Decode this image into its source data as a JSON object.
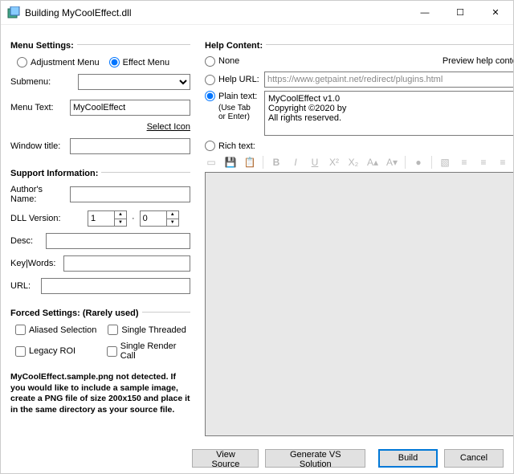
{
  "title": "Building MyCoolEffect.dll",
  "menu_settings": {
    "header": "Menu Settings:",
    "adjustment_label": "Adjustment Menu",
    "effect_label": "Effect Menu",
    "submenu_label": "Submenu:",
    "submenu_value": "",
    "menu_text_label": "Menu Text:",
    "menu_text_value": "MyCoolEffect",
    "select_icon": "Select Icon",
    "window_title_label": "Window title:",
    "window_title_value": ""
  },
  "support": {
    "header": "Support Information:",
    "author_label": "Author's Name:",
    "author_value": "",
    "dll_version_label": "DLL Version:",
    "dll_major": "1",
    "dll_minor": "0",
    "desc_label": "Desc:",
    "desc_value": "",
    "keywords_label": "Key|Words:",
    "keywords_value": "",
    "url_label": "URL:",
    "url_value": ""
  },
  "forced": {
    "header": "Forced Settings: (Rarely used)",
    "aliased": "Aliased Selection",
    "single_thread": "Single Threaded",
    "legacy_roi": "Legacy ROI",
    "single_render": "Single Render Call"
  },
  "notice": "MyCoolEffect.sample.png not detected.  If you would like to include a sample image, create a PNG file of size 200x150 and place it in the same directory as your source file.",
  "help": {
    "header": "Help Content:",
    "none": "None",
    "preview_label": "Preview help content:",
    "help_url_label": "Help URL:",
    "url_placeholder": "https://www.getpaint.net/redirect/plugins.html",
    "plain_label": "Plain text:",
    "plain_sub": "(Use Tab or Enter)",
    "plain_line1": "MyCoolEffect v1.0",
    "plain_line2": "Copyright ©2020 by",
    "plain_line3": "All rights reserved.",
    "rich_label": "Rich text:"
  },
  "footer": {
    "view_source": "View Source",
    "gen_vs": "Generate VS Solution",
    "build": "Build",
    "cancel": "Cancel"
  }
}
